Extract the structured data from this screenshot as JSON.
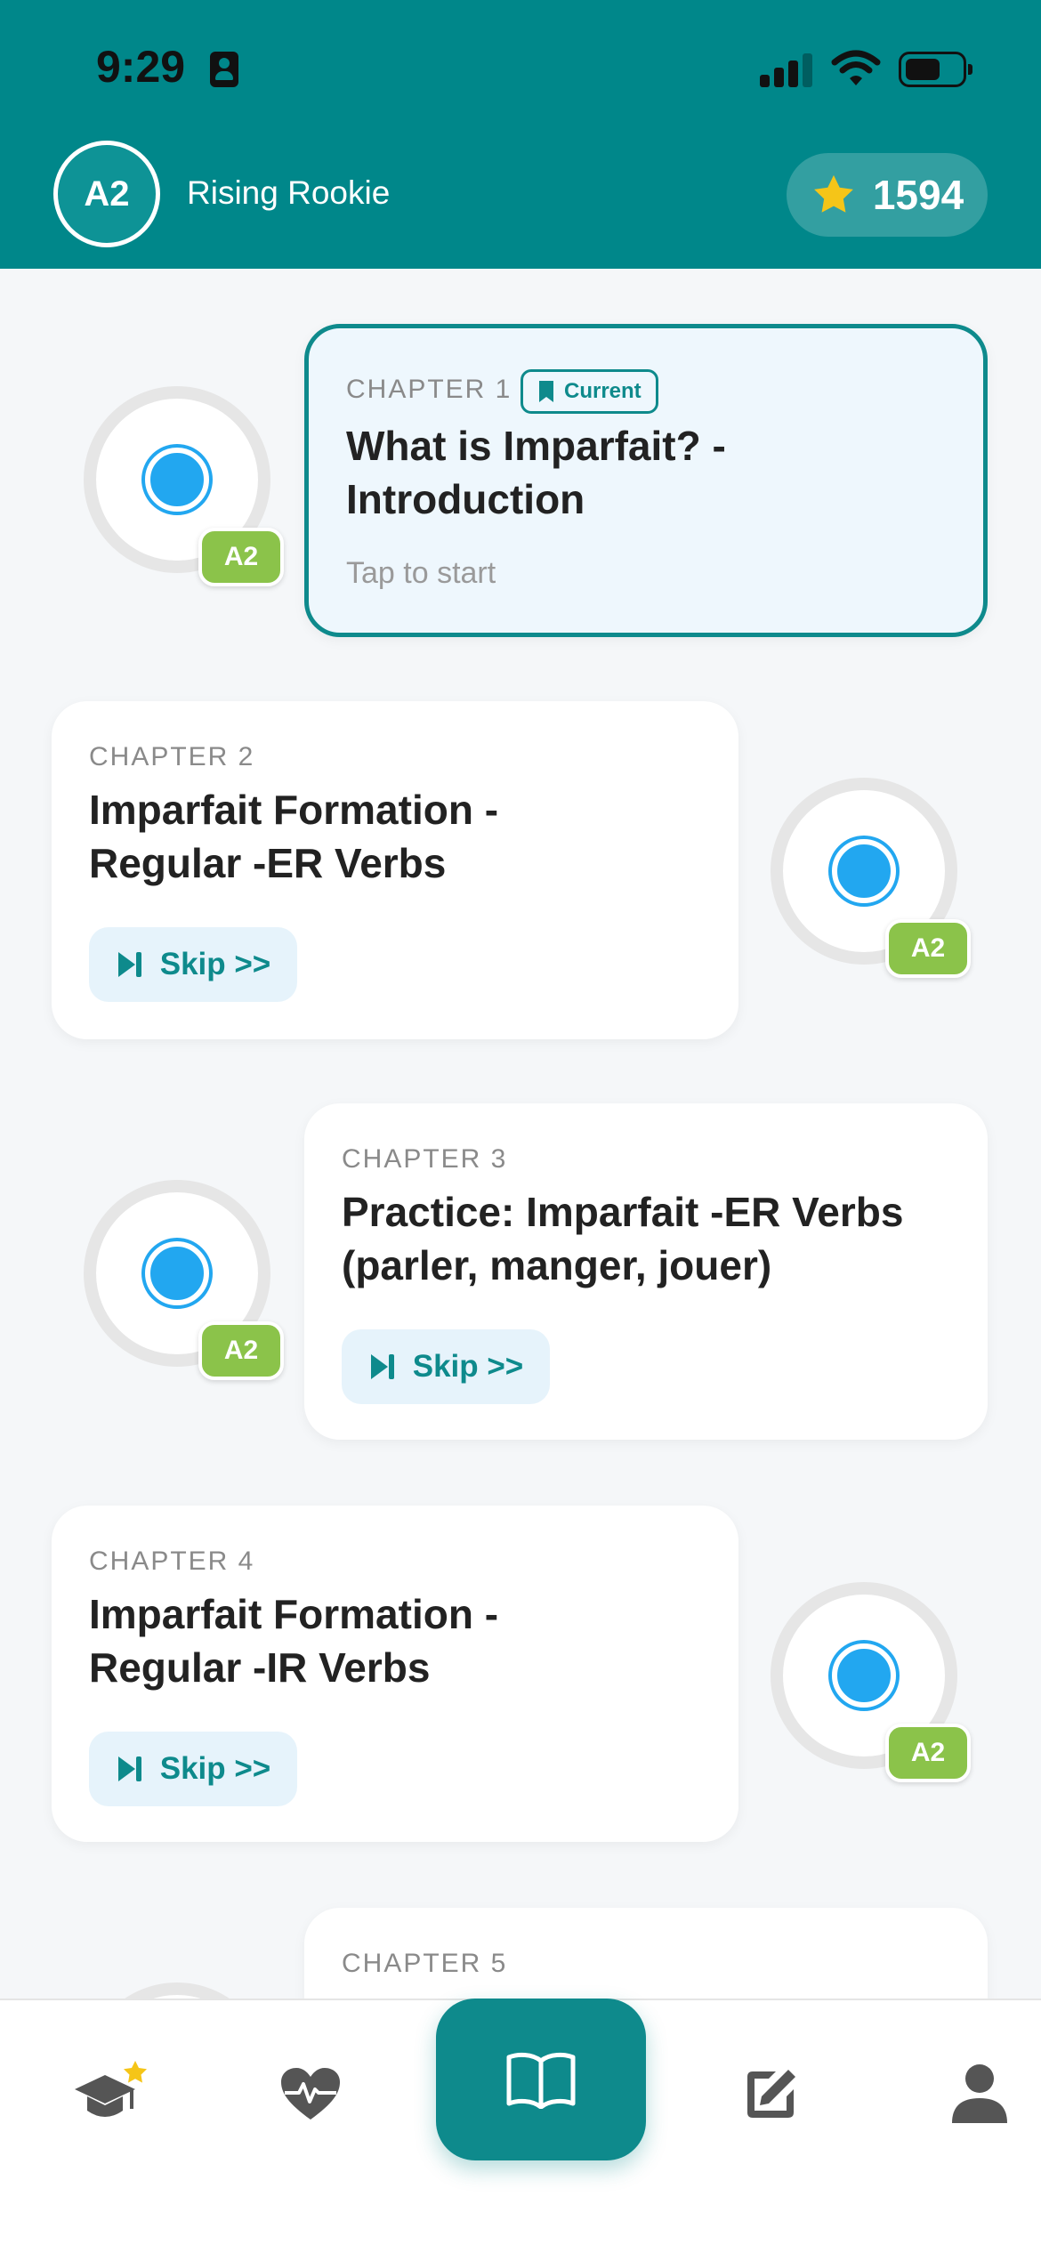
{
  "status_bar": {
    "time": "9:29"
  },
  "header": {
    "level_code": "A2",
    "level_name": "Rising Rookie",
    "points": "1594"
  },
  "chapters": [
    {
      "label": "CHAPTER 1",
      "title": "What is Imparfait? - Introduction",
      "title_lines": [
        "What is Imparfait? -",
        "Introduction"
      ],
      "level": "A2",
      "current_badge": "Current",
      "tap_text": "Tap to start"
    },
    {
      "label": "CHAPTER 2",
      "title": "Imparfait Formation - Regular -ER Verbs",
      "title_lines": [
        "Imparfait Formation -",
        "Regular -ER Verbs"
      ],
      "level": "A2",
      "skip_label": "Skip >>"
    },
    {
      "label": "CHAPTER 3",
      "title": "Practice: Imparfait -ER Verbs (parler, manger, jouer)",
      "title_lines": [
        "Practice: Imparfait -ER Verbs",
        "(parler, manger, jouer)"
      ],
      "level": "A2",
      "skip_label": "Skip >>"
    },
    {
      "label": "CHAPTER 4",
      "title": "Imparfait Formation - Regular -IR Verbs",
      "title_lines": [
        "Imparfait Formation -",
        "Regular -IR Verbs"
      ],
      "level": "A2",
      "skip_label": "Skip >>"
    },
    {
      "label": "CHAPTER 5"
    }
  ],
  "nav": {
    "items": [
      "graduation-cap-icon",
      "heart-pulse-icon",
      "book-icon",
      "edit-icon",
      "profile-icon"
    ],
    "active": "book-icon"
  },
  "colors": {
    "header": "#00878a",
    "accent": "#0e8a8c",
    "badge": "#8bc34a",
    "dot": "#22a7f0",
    "star": "#f5c518"
  }
}
